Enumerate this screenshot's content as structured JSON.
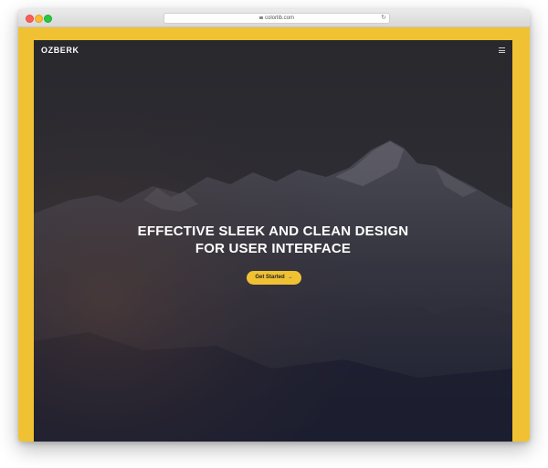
{
  "browser": {
    "url": "colorlib.com",
    "lock_icon": "lock-icon",
    "reload_icon": "reload-icon"
  },
  "site": {
    "logo": "OZBERK",
    "menu_icon": "hamburger-menu-icon",
    "headline_line1": "EFFECTIVE SLEEK AND CLEAN DESIGN",
    "headline_line2": "FOR USER INTERFACE",
    "cta_label": "Get Started",
    "cta_arrow": "→"
  },
  "colors": {
    "accent": "#f0c233",
    "hero_dark": "#2b2b2f",
    "text": "#ffffff"
  }
}
